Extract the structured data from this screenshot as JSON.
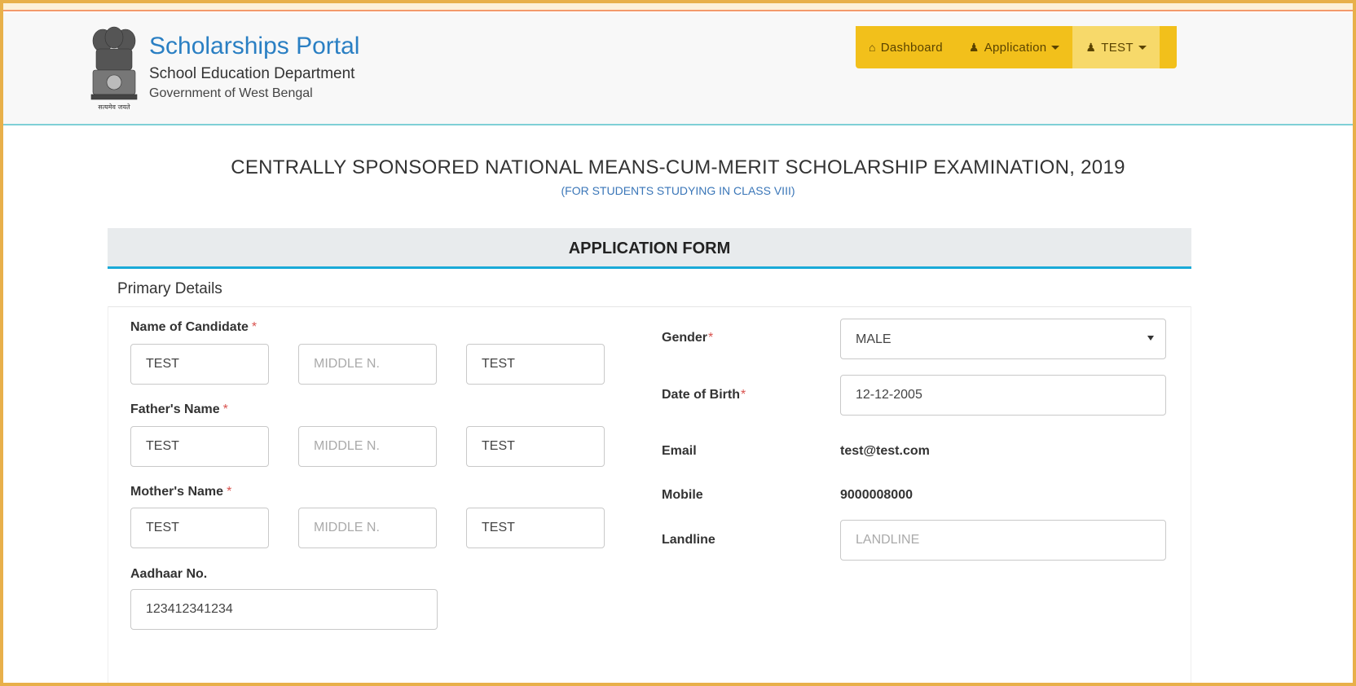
{
  "header": {
    "brand_title": "Scholarships Portal",
    "brand_sub": "School Education Department",
    "brand_sub2": "Government of West Bengal",
    "emblem_caption": "सत्यमेव जयते"
  },
  "nav": {
    "items": [
      {
        "label": "Dashboard",
        "icon": "home-icon"
      },
      {
        "label": "Application",
        "icon": "user-icon"
      },
      {
        "label": "TEST",
        "icon": "user-icon"
      }
    ]
  },
  "page": {
    "exam_title": "CENTRALLY SPONSORED NATIONAL MEANS-CUM-MERIT SCHOLARSHIP EXAMINATION, 2019",
    "exam_subtitle": "(FOR STUDENTS STUDYING IN CLASS VIII)",
    "form_title": "APPLICATION FORM",
    "section_title": "Primary Details"
  },
  "form": {
    "required_mark": "*",
    "candidate": {
      "label": "Name of Candidate",
      "first": "TEST",
      "middle_placeholder": "MIDDLE N.",
      "last": "TEST"
    },
    "father": {
      "label": "Father's Name",
      "first": "TEST",
      "middle_placeholder": "MIDDLE N.",
      "last": "TEST"
    },
    "mother": {
      "label": "Mother's Name",
      "first": "TEST",
      "middle_placeholder": "MIDDLE N.",
      "last": "TEST"
    },
    "aadhaar": {
      "label": "Aadhaar No.",
      "value": "123412341234"
    },
    "gender": {
      "label": "Gender",
      "value": "MALE"
    },
    "dob": {
      "label": "Date of Birth",
      "value": "12-12-2005"
    },
    "email": {
      "label": "Email",
      "value": "test@test.com"
    },
    "mobile": {
      "label": "Mobile",
      "value": "9000008000"
    },
    "landline": {
      "label": "Landline",
      "placeholder": "LANDLINE"
    }
  },
  "colors": {
    "accent_blue": "#2a7fc3",
    "nav_yellow": "#f2c01b",
    "banner_border": "#1aaad8",
    "required_red": "#d9534f"
  }
}
